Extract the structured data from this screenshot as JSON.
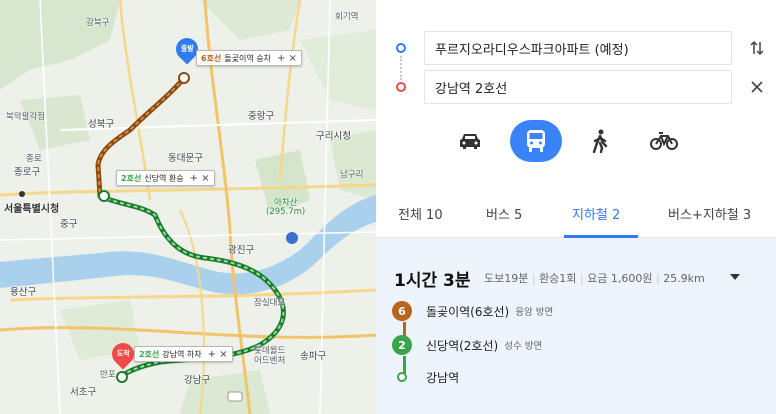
{
  "map": {
    "labels": {
      "gangbuk": "강북구",
      "hoegi": "회기역",
      "bukhansan": "북악팔각정",
      "seongbuk": "성북구",
      "jongno": "종로",
      "jongno_gu": "종로구",
      "jung_gu": "중구",
      "seoul_city_hall": "서울특별시청",
      "dongdaemun": "동대문구",
      "jungnang": "중랑구",
      "guri": "구리시청",
      "gwangjin": "광진구",
      "achasan": "아차산",
      "achasan_height": "(295.7m)",
      "namguri": "남구리",
      "yongsan": "용산구",
      "seongdong": "성동구",
      "songpa": "송파구",
      "gangnam": "강남구",
      "seocho": "서초구",
      "banpo": "반포",
      "lotte": "롯데월드",
      "lotte2": "어드벤처",
      "jamsil_bridge": "잠실대교",
      "olympic": "올림픽대로",
      "yeonnam": "용산구",
      "dongjak": "동작",
      "sangbong": "상봉역"
    },
    "start_pin": "출발",
    "end_pin": "도착",
    "callouts": [
      {
        "line": "6호선",
        "text": "돌곶이역 승차",
        "line_color": "#b5651d"
      },
      {
        "line": "2호선",
        "text": "신당역 환승",
        "line_color": "#3aa64b"
      },
      {
        "line": "2호선",
        "text": "강남역 하차",
        "line_color": "#3aa64b"
      }
    ],
    "callout_controls": "+ ×",
    "colors": {
      "line6": "#b5651d",
      "line2": "#3aa64b",
      "start": "#2f7cf0",
      "end": "#f04a4a"
    }
  },
  "panel": {
    "origin": "푸르지오라디우스파크아파트 (예정)",
    "destination": "강남역 2호선",
    "swap_icon": "swap-icon",
    "close_icon": "close-icon",
    "modes": [
      {
        "name": "car",
        "icon": "car-icon",
        "active": false
      },
      {
        "name": "transit",
        "icon": "bus-icon",
        "active": true
      },
      {
        "name": "walk",
        "icon": "walk-icon",
        "active": false
      },
      {
        "name": "bike",
        "icon": "bike-icon",
        "active": false
      }
    ],
    "tabs": [
      {
        "label": "전체 10",
        "active": false
      },
      {
        "label": "버스 5",
        "active": false
      },
      {
        "label": "지하철 2",
        "active": true
      },
      {
        "label": "버스+지하철 3",
        "active": false
      }
    ],
    "result": {
      "duration": "1시간 3분",
      "walk": "도보19분",
      "transfers": "환승1회",
      "fare": "요금 1,600원",
      "distance": "25.9km",
      "steps": [
        {
          "badge": "6",
          "station": "돌곶이역(6호선)",
          "direction": "응암 방면",
          "color": "#b5651d"
        },
        {
          "badge": "2",
          "station": "신당역(2호선)",
          "direction": "성수 방면",
          "color": "#3aa64b"
        },
        {
          "badge": "",
          "station": "강남역",
          "direction": "",
          "color": "#3aa64b"
        }
      ]
    }
  }
}
